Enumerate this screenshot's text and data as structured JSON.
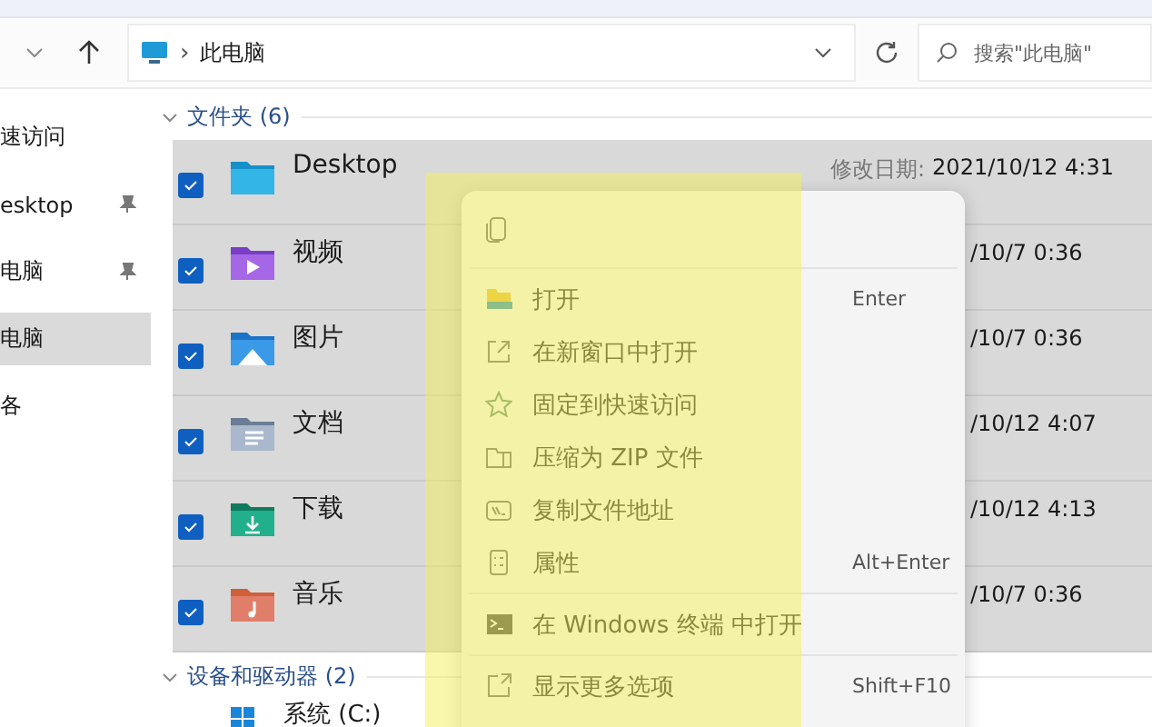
{
  "toolbar": {
    "address": {
      "separator": "›",
      "location": "此电脑"
    },
    "search": {
      "placeholder": "搜索\"此电脑\""
    }
  },
  "sidebar": {
    "items": [
      {
        "label": "速访问",
        "pinned": false,
        "selected": false
      },
      {
        "label": "esktop",
        "pinned": true,
        "selected": false
      },
      {
        "label": "电脑",
        "pinned": true,
        "selected": false
      },
      {
        "label": "电脑",
        "pinned": false,
        "selected": true
      },
      {
        "label": "各",
        "pinned": false,
        "selected": false
      }
    ]
  },
  "groups": [
    {
      "title": "文件夹 (6)",
      "expanded": true,
      "items": [
        {
          "name": "Desktop",
          "date_label": "修改日期:",
          "date": "2021/10/12 4:31",
          "selected": true,
          "checked": true
        },
        {
          "name": "视频",
          "date": "/10/7 0:36",
          "selected": true,
          "checked": true
        },
        {
          "name": "图片",
          "date": "/10/7 0:36",
          "selected": true,
          "checked": true
        },
        {
          "name": "文档",
          "date": "/10/12 4:07",
          "selected": true,
          "checked": true
        },
        {
          "name": "下载",
          "date": "/10/12 4:13",
          "selected": true,
          "checked": true
        },
        {
          "name": "音乐",
          "date": "/10/7 0:36",
          "selected": true,
          "checked": true
        }
      ]
    },
    {
      "title": "设备和驱动器 (2)",
      "expanded": true,
      "items": [
        {
          "name": "系统 (C:)",
          "selected": false
        }
      ]
    }
  ],
  "context_menu": {
    "sections": [
      [
        {
          "label": "打开",
          "shortcut": "Enter"
        },
        {
          "label": "在新窗口中打开"
        },
        {
          "label": "固定到快速访问"
        },
        {
          "label": "压缩为 ZIP 文件"
        },
        {
          "label": "复制文件地址"
        },
        {
          "label": "属性",
          "shortcut": "Alt+Enter"
        }
      ],
      [
        {
          "label": "在 Windows 终端 中打开"
        }
      ],
      [
        {
          "label": "显示更多选项",
          "shortcut": "Shift+F10"
        }
      ]
    ]
  }
}
